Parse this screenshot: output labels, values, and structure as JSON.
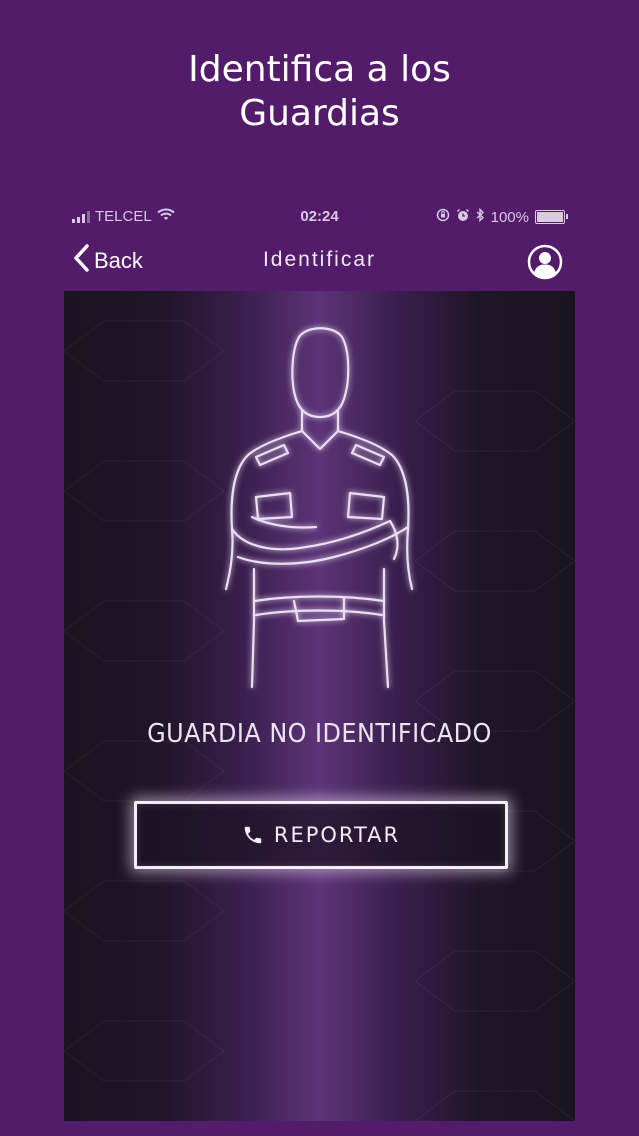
{
  "promo": {
    "title_line1": "Identifica a los",
    "title_line2": "Guardias"
  },
  "status_bar": {
    "carrier": "TELCEL",
    "time": "02:24",
    "battery": "100%",
    "icons": [
      "signal-icon",
      "wifi-icon",
      "lock-rotation-icon",
      "alarm-icon",
      "bluetooth-icon",
      "battery-icon"
    ]
  },
  "nav": {
    "back_label": "Back",
    "title": "Identificar",
    "back_icon": "chevron-left-icon",
    "profile_icon": "user-avatar-icon"
  },
  "main": {
    "status_message": "GUARDIA NO IDENTIFICADO",
    "report_label": "REPORTAR",
    "report_icon": "phone-icon"
  },
  "colors": {
    "background": "#521c6b",
    "panel_glow": "#5d3478",
    "outline": "#e8d8f2"
  }
}
